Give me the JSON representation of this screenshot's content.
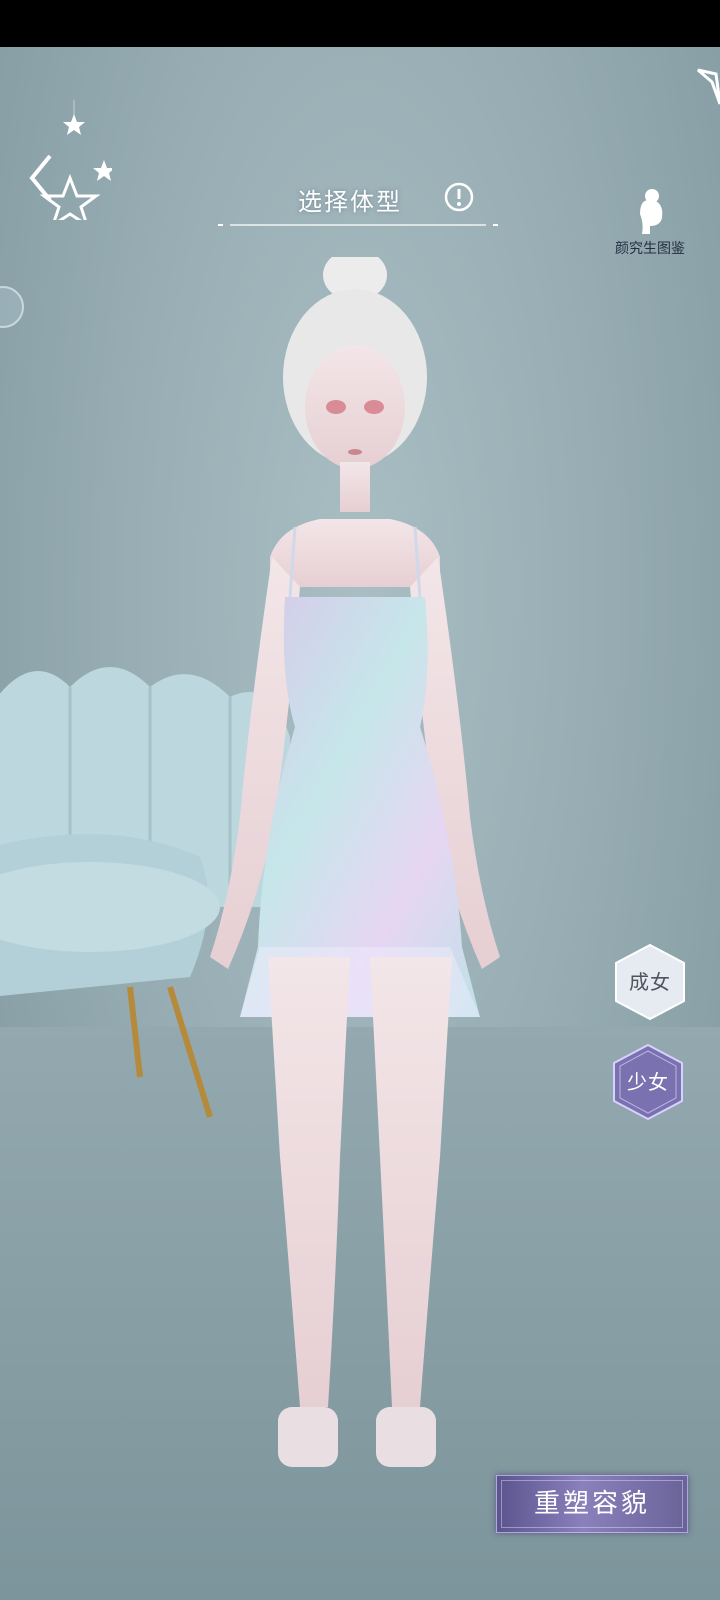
{
  "header": {
    "title": "选择体型",
    "info_icon": "info-icon"
  },
  "studio": {
    "label": "颜究生图鉴",
    "icon": "female-silhouette-icon"
  },
  "body_types": {
    "adult_label": "成女",
    "teen_label": "少女",
    "selected": "少女"
  },
  "actions": {
    "reshape_label": "重塑容貌"
  },
  "icons": {
    "back": "chevron-left-star-icon",
    "stars": "star-icon"
  },
  "colors": {
    "background": "#98aeb4",
    "accent_purple": "#7a72b0",
    "hex_light": "#e8edf2",
    "dress": "#c9d8f0"
  }
}
